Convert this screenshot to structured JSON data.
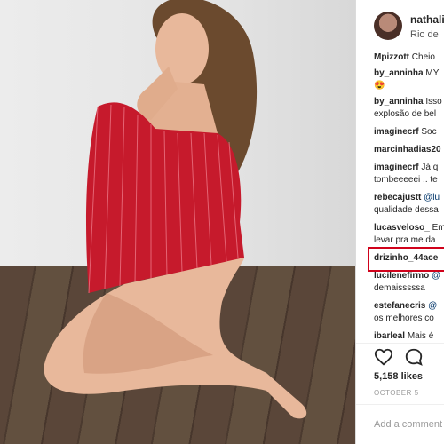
{
  "post": {
    "username": "nathali",
    "location": "Rio de",
    "likes": "5,158 likes",
    "date": "OCTOBER 5",
    "add_comment_placeholder": "Add a comment"
  },
  "comments": [
    {
      "user": "Mpizzott",
      "text": "Cheio"
    },
    {
      "user": "by_anninha",
      "text": "MY"
    },
    {
      "user": "",
      "text": "😍"
    },
    {
      "user": "by_anninha",
      "text": "Isso"
    },
    {
      "user": "",
      "text": "explosão de bel"
    },
    {
      "user": "imaginecrf",
      "text": "Soc"
    },
    {
      "user": "marcinhadias20",
      "text": ""
    },
    {
      "user": "imaginecrf",
      "text": "Já q"
    },
    {
      "user": "",
      "text": "tombeeeeei .. te"
    },
    {
      "user": "rebecajustt",
      "text": "@lu"
    },
    {
      "user": "",
      "text": "qualidade dessa"
    },
    {
      "user": "lucasveloso_",
      "text": "Em"
    },
    {
      "user": "",
      "text": "levar pra me da"
    },
    {
      "user": "drizinho_44ace",
      "text": ""
    },
    {
      "user": "lucilenefirmo",
      "text": "@"
    },
    {
      "user": "",
      "text": "demaisssssa"
    },
    {
      "user": "estefanecris",
      "text": "@"
    },
    {
      "user": "",
      "text": "os melhores co"
    },
    {
      "user": "ibarleal",
      "text": "Mais é"
    }
  ],
  "colors": {
    "highlight": "#d0021b",
    "link": "#003569"
  },
  "icons": [
    "heart-icon",
    "comment-icon"
  ]
}
